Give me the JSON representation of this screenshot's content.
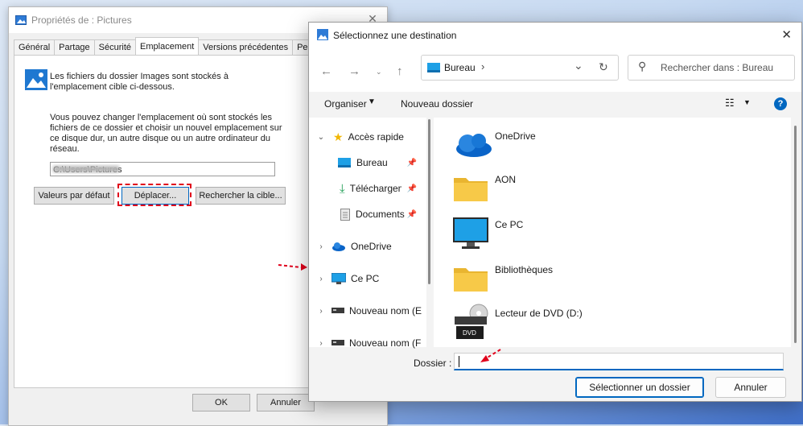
{
  "colors": {
    "accent": "#0067c0",
    "red_marker": "#e0001b",
    "folder_yellow": "#f7c948"
  },
  "props": {
    "title": "Propriétés de : Pictures",
    "tabs": [
      "Général",
      "Partage",
      "Sécurité",
      "Emplacement",
      "Versions précédentes",
      "Pers"
    ],
    "active_tab": "Emplacement",
    "desc1": "Les fichiers du dossier Images sont stockés à l'emplacement cible ci-dessous.",
    "desc2": "Vous pouvez changer l'emplacement où sont stockés les fichiers de ce dossier et choisir un nouvel emplacement sur ce disque dur, un autre disque ou un autre ordinateur du réseau.",
    "path_value": "C:\\Users\\Pictures",
    "buttons": {
      "default": "Valeurs par défaut",
      "move": "Déplacer...",
      "find": "Rechercher la cible..."
    },
    "ok": "OK",
    "cancel": "Annuler"
  },
  "picker": {
    "title": "Sélectionnez une destination",
    "address": "Bureau",
    "search_placeholder": "Rechercher dans : Bureau",
    "organise": "Organiser",
    "new_folder": "Nouveau dossier",
    "help": "?",
    "nav": [
      {
        "label": "Accès rapide",
        "icon": "star-icon"
      },
      {
        "label": "Bureau",
        "icon": "desktop-icon"
      },
      {
        "label": "Téléchargements",
        "icon": "download-icon"
      },
      {
        "label": "Documents",
        "icon": "documents-icon"
      },
      {
        "label": "OneDrive",
        "icon": "cloud-icon"
      },
      {
        "label": "Ce PC",
        "icon": "monitor-icon"
      },
      {
        "label": "Nouveau nom (E",
        "icon": "drive-icon"
      },
      {
        "label": "Nouveau nom (F",
        "icon": "drive-icon"
      }
    ],
    "items": [
      {
        "label": "OneDrive",
        "icon": "cloud-icon"
      },
      {
        "label": "AON",
        "icon": "folder-icon"
      },
      {
        "label": "Ce PC",
        "icon": "monitor-icon"
      },
      {
        "label": "Bibliothèques",
        "icon": "folder-icon"
      },
      {
        "label": "Lecteur de DVD (D:)",
        "icon": "dvd-icon"
      }
    ],
    "folder_label": "Dossier :",
    "folder_value": "",
    "dvd_badge": "DVD",
    "select_button": "Sélectionner un dossier",
    "cancel_button": "Annuler"
  }
}
